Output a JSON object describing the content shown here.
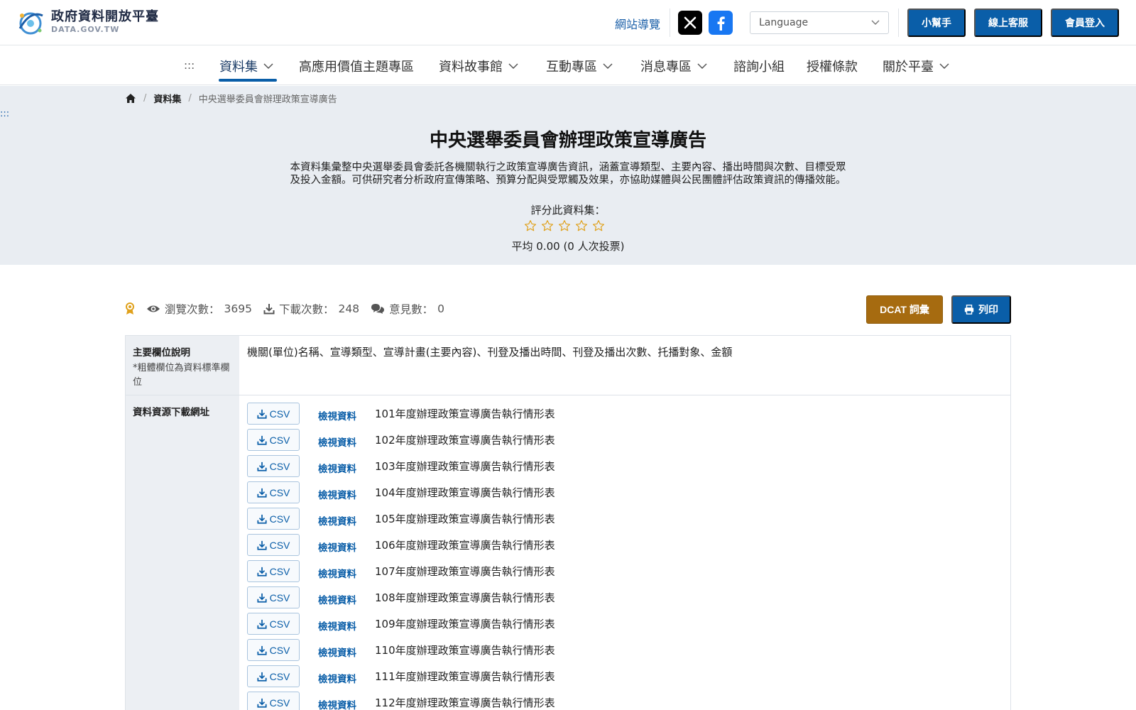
{
  "header": {
    "logo_title": "政府資料開放平臺",
    "logo_subtitle": "DATA.GOV.TW",
    "sitemap_label": "網站導覽",
    "language_placeholder": "Language",
    "buttons": {
      "helper": "小幫手",
      "support": "線上客服",
      "login": "會員登入"
    },
    "colors": {
      "primary": "#0a5ea8",
      "accent": "#a66b10",
      "hero_bg": "#e9edf2"
    }
  },
  "nav": {
    "skip": ":::",
    "items": [
      {
        "label": "資料集",
        "dropdown": true,
        "active": true
      },
      {
        "label": "高應用價值主題專區",
        "dropdown": false
      },
      {
        "label": "資料故事館",
        "dropdown": true
      },
      {
        "label": "互動專區",
        "dropdown": true
      },
      {
        "label": "消息專區",
        "dropdown": true
      },
      {
        "label": "諮詢小組",
        "dropdown": false
      },
      {
        "label": "授權條款",
        "dropdown": false
      },
      {
        "label": "關於平臺",
        "dropdown": true
      }
    ]
  },
  "breadcrumb": {
    "level1": "資料集",
    "current": "中央選舉委員會辦理政策宣導廣告"
  },
  "hero": {
    "skip": ":::",
    "title": "中央選舉委員會辦理政策宣導廣告",
    "description_line1": "本資料集彙整中央選舉委員會委託各機關執行之政策宣導廣告資訊，涵蓋宣導類型、主要內容、播出時間與次數、目標受眾",
    "description_line2": "及投入金額。可供研究者分析政府宣傳策略、預算分配與受眾觸及效果，亦協助媒體與公民團體評估政策資訊的傳播效能。",
    "rate_label": "評分此資料集：",
    "rating_avg": "平均 0.00 (0 人次投票)",
    "stars_filled": 0,
    "stars_total": 5
  },
  "stats": {
    "views_label": "瀏覽次數：",
    "views": "3695",
    "downloads_label": "下載次數：",
    "downloads": "248",
    "comments_label": "意見數：",
    "comments": "0"
  },
  "actions": {
    "dcat": "DCAT 詞彙",
    "print": "列印"
  },
  "table": {
    "fields_header": "主要欄位說明",
    "fields_note": "*粗體欄位為資料標準欄位",
    "fields_value": "機關(單位)名稱、宣導類型、宣導計畫(主要內容)、刊登及播出時間、刊登及播出次數、托播對象、金額",
    "resources_header": "資料資源下載網址",
    "csv_label": "CSV",
    "view_label": "檢視資料",
    "resources": [
      "101年度辦理政策宣導廣告執行情形表",
      "102年度辦理政策宣導廣告執行情形表",
      "103年度辦理政策宣導廣告執行情形表",
      "104年度辦理政策宣導廣告執行情形表",
      "105年度辦理政策宣導廣告執行情形表",
      "106年度辦理政策宣導廣告執行情形表",
      "107年度辦理政策宣導廣告執行情形表",
      "108年度辦理政策宣導廣告執行情形表",
      "109年度辦理政策宣導廣告執行情形表",
      "110年度辦理政策宣導廣告執行情形表",
      "111年度辦理政策宣導廣告執行情形表",
      "112年度辦理政策宣導廣告執行情形表"
    ]
  }
}
